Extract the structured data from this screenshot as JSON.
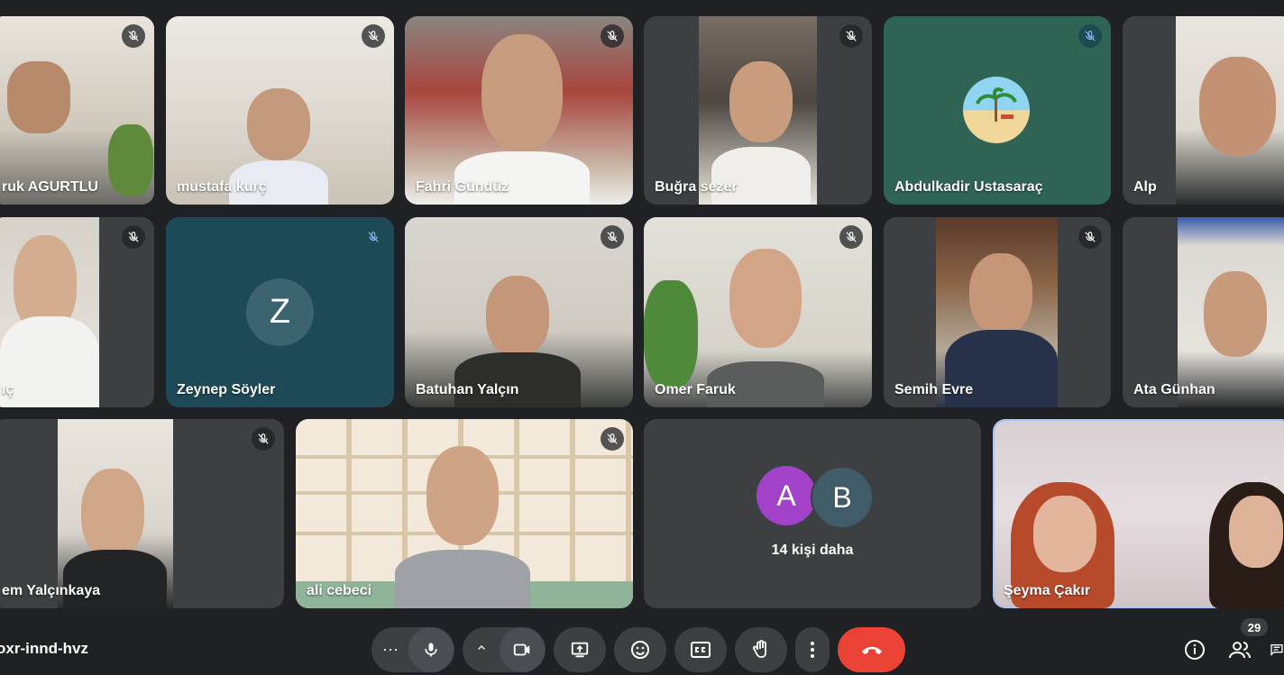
{
  "participants": [
    {
      "name": "ruk AGURTLU",
      "muted": true
    },
    {
      "name": "mustafa kurç",
      "muted": true
    },
    {
      "name": "Fahri Gündüz",
      "muted": true
    },
    {
      "name": "Buğra sezer",
      "muted": true
    },
    {
      "name": "Abdulkadir Ustasaraç",
      "muted": true
    },
    {
      "name": "Alp",
      "muted": false
    },
    {
      "name": "ıç",
      "muted": true
    },
    {
      "name": "Zeynep Söyler",
      "muted": true,
      "initial": "Z"
    },
    {
      "name": "Batuhan Yalçın",
      "muted": true
    },
    {
      "name": "Omer Faruk",
      "muted": true
    },
    {
      "name": "Semih Evre",
      "muted": true
    },
    {
      "name": "Ata Günhan",
      "muted": false
    },
    {
      "name": "em Yalçınkaya",
      "muted": true
    },
    {
      "name": "ali cebeci",
      "muted": true
    },
    {
      "name": "Şeyma Çakır",
      "muted": false
    }
  ],
  "overflow": {
    "avatars": [
      "A",
      "B"
    ],
    "label": "14 kişi daha"
  },
  "bottom_bar": {
    "meeting_code": "oxr-innd-hvz",
    "participant_count": "29"
  },
  "colors": {
    "background": "#202124",
    "tile": "#3c4043",
    "end_call": "#ea4335",
    "avatar_a": "#a142c9",
    "avatar_b": "#3f5c68"
  }
}
